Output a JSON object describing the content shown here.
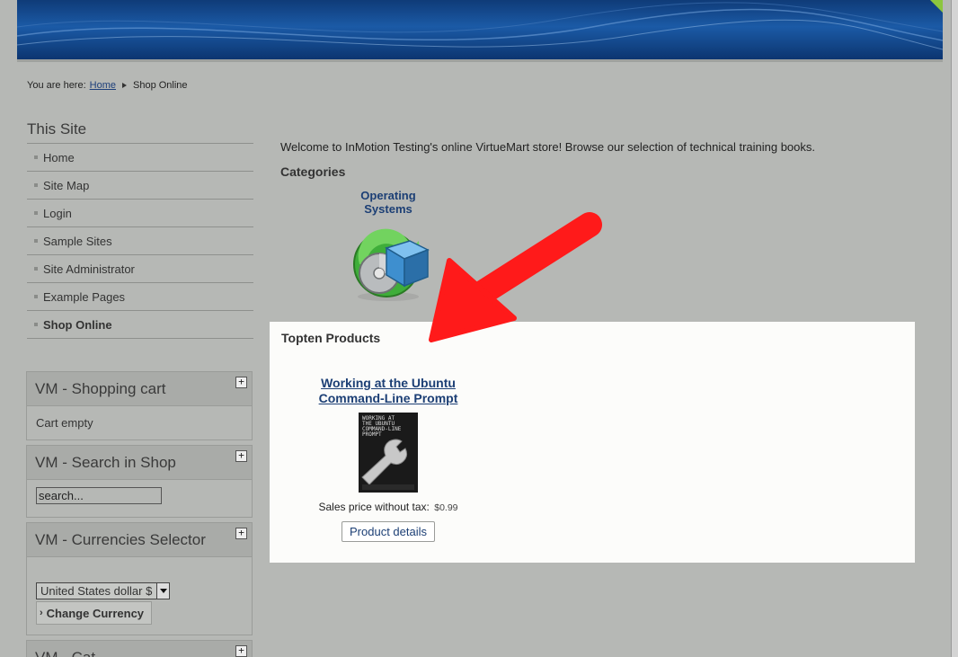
{
  "breadcrumb": {
    "prefix": "You are here:",
    "home": "Home",
    "current": "Shop Online"
  },
  "sidebar": {
    "title": "This Site",
    "items": [
      {
        "label": "Home"
      },
      {
        "label": "Site Map"
      },
      {
        "label": "Login"
      },
      {
        "label": "Sample Sites"
      },
      {
        "label": "Site Administrator"
      },
      {
        "label": "Example Pages"
      },
      {
        "label": "Shop Online"
      }
    ],
    "active_item": "Shop Online"
  },
  "modules": {
    "cart": {
      "title": "VM - Shopping cart",
      "body": "Cart empty",
      "toggle": "+"
    },
    "search": {
      "title": "VM - Search in Shop",
      "placeholder": "search...",
      "toggle": "+"
    },
    "currency": {
      "title": "VM - Currencies Selector",
      "selected": "United States dollar $",
      "button": "Change Currency",
      "toggle": "+"
    },
    "next": {
      "title": "VM - Cat",
      "toggle": "+"
    }
  },
  "main": {
    "welcome": "Welcome to InMotion Testing's online VirtueMart store! Browse our selection of technical training books.",
    "categories_heading": "Categories",
    "category": {
      "title": "Operating Systems",
      "icon": "os-box-disc-icon"
    },
    "topten_heading": "Topten Products",
    "product": {
      "title_line1": "Working at the Ubuntu",
      "title_line2": "Command-Line Prompt",
      "cover_text": "WORKING AT\nTHE UBUNTU\nCOMMAND-LINE\nPROMPT",
      "price_label": "Sales price without tax:",
      "price_value": "$0.99",
      "details_button": "Product details"
    }
  },
  "colors": {
    "link": "#1c3f75",
    "background": "#b6b8b5",
    "panel": "#fcfcfa",
    "annotation_arrow": "#ff1a1a"
  }
}
